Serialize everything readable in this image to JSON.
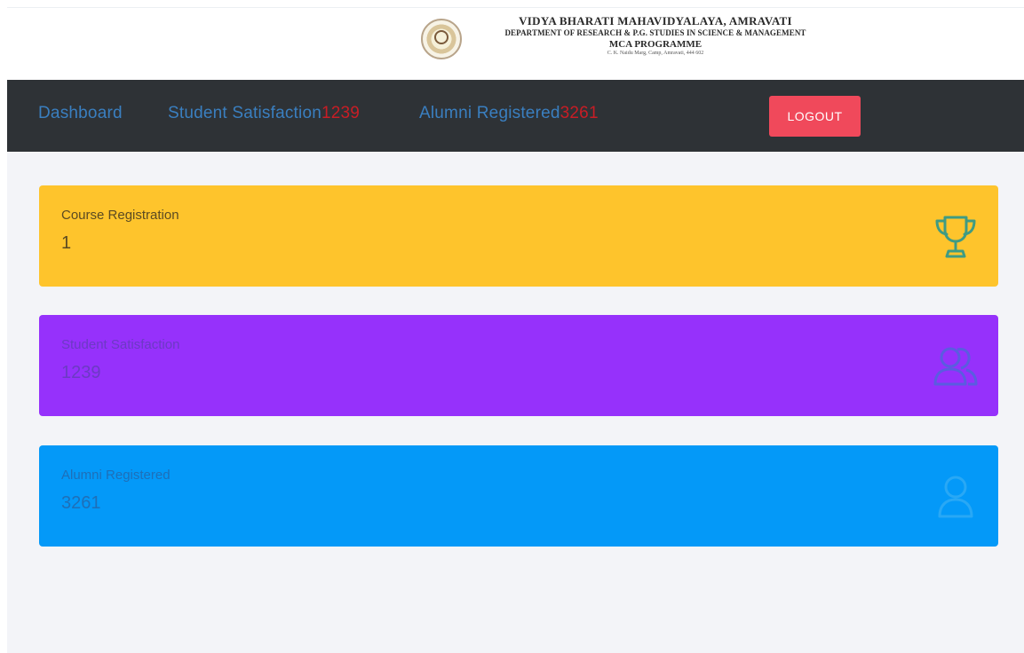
{
  "header": {
    "title": "VIDYA BHARATI MAHAVIDYALAYA, AMRAVATI",
    "department": "DEPARTMENT OF RESEARCH & P.G. STUDIES IN SCIENCE & MANAGEMENT",
    "programme": "MCA PROGRAMME",
    "address": "C. K. Naidu Marg, Camp, Amravati, 444 602"
  },
  "navbar": {
    "dashboard": "Dashboard",
    "student_satisfaction": "Student Satisfaction",
    "student_satisfaction_badge": "1239",
    "alumni_registered": "Alumni Registered",
    "alumni_registered_badge": "3261",
    "logout": "LOGOUT"
  },
  "cards": [
    {
      "label": "Course Registration",
      "value": "1",
      "icon": "trophy-icon",
      "color": "#fec42c"
    },
    {
      "label": "Student Satisfaction",
      "value": "1239",
      "icon": "users-icon",
      "color": "#9631fb"
    },
    {
      "label": "Alumni Registered",
      "value": "3261",
      "icon": "user-icon",
      "color": "#0499f8"
    }
  ],
  "colors": {
    "navbar": "#2e3236",
    "nav_link": "#3a7fc0",
    "badge": "#c81d25",
    "logout": "#f0495b",
    "background": "#f3f4f8"
  }
}
